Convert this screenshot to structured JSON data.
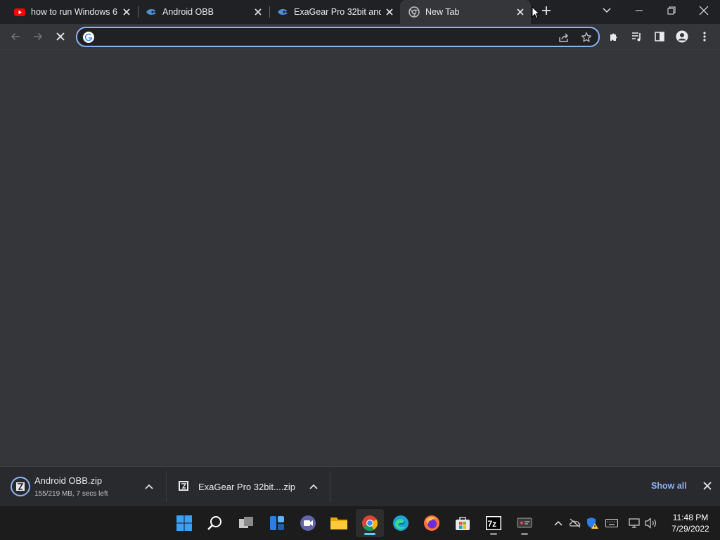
{
  "browser": {
    "tabs": [
      {
        "title": "how to run Windows 6",
        "favicon": "youtube-icon",
        "active": false
      },
      {
        "title": "Android OBB",
        "favicon": "mediafire-icon",
        "active": false
      },
      {
        "title": "ExaGear Pro 32bit and",
        "favicon": "mediafire-icon",
        "active": false
      },
      {
        "title": "New Tab",
        "favicon": "chrome-icon",
        "active": true
      }
    ],
    "omnibox": {
      "value": "",
      "placeholder": ""
    }
  },
  "downloads": {
    "items": [
      {
        "name": "Android OBB.zip",
        "status": "155/219 MB, 7 secs left",
        "icon": "7zip-icon"
      },
      {
        "name": "ExaGear Pro 32bit....zip",
        "status": "",
        "icon": "7zip-icon"
      }
    ],
    "show_all_label": "Show all"
  },
  "taskbar": {
    "apps": [
      "start-icon",
      "search-icon",
      "task-view-icon",
      "widgets-icon",
      "teams-chat-icon",
      "file-explorer-icon",
      "chrome-icon",
      "edge-icon",
      "firefox-icon",
      "store-icon",
      "7zip-icon",
      "screen-capture-icon"
    ],
    "active_app": "chrome-icon",
    "clock": {
      "time": "11:48 PM",
      "date": "7/29/2022"
    }
  },
  "colors": {
    "accent": "#8ab4f8",
    "tab_strip": "#202124",
    "toolbar": "#35363a",
    "taskbar": "#1c1c1c",
    "active_indicator": "#60cdff"
  }
}
